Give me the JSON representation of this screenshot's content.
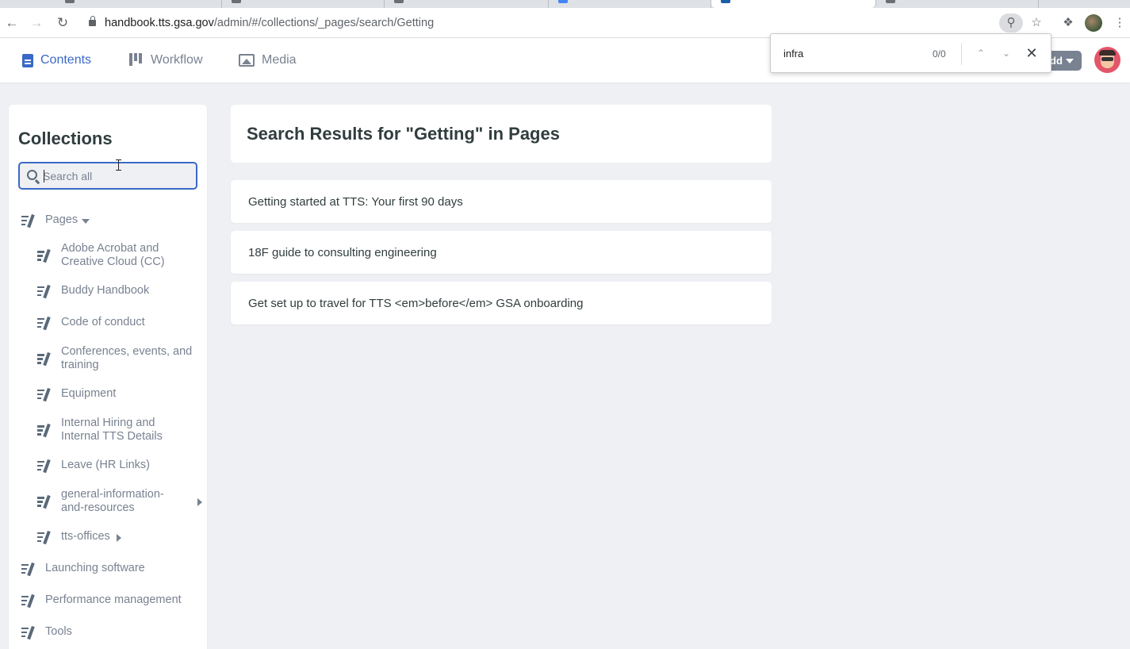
{
  "browser": {
    "url_host": "handbook.tts.gsa.gov",
    "url_path": "/admin/#/collections/_pages/search/Getting"
  },
  "find_bar": {
    "query": "infra",
    "count": "0/0"
  },
  "app_nav": {
    "contents": "Contents",
    "workflow": "Workflow",
    "media": "Media",
    "quick_add": "dd"
  },
  "sidebar": {
    "title": "Collections",
    "search_placeholder": "Search all",
    "pages_label": "Pages",
    "page_items": [
      "Adobe Acrobat and Creative Cloud (CC)",
      "Buddy Handbook",
      "Code of conduct",
      "Conferences, events, and training",
      "Equipment",
      "Internal Hiring and Internal TTS Details",
      "Leave (HR Links)",
      "general-information-and-resources",
      "tts-offices"
    ],
    "collections": [
      "Launching software",
      "Performance management",
      "Tools"
    ]
  },
  "main": {
    "heading": "Search Results for \"Getting\" in Pages",
    "results": [
      "Getting started at TTS: Your first 90 days",
      "18F guide to consulting engineering",
      "Get set up to travel for TTS <em>before</em> GSA onboarding"
    ]
  },
  "colors": {
    "accent": "#3a69c7",
    "background": "#eff0f4",
    "text": "#313d3e",
    "muted": "#798291"
  }
}
